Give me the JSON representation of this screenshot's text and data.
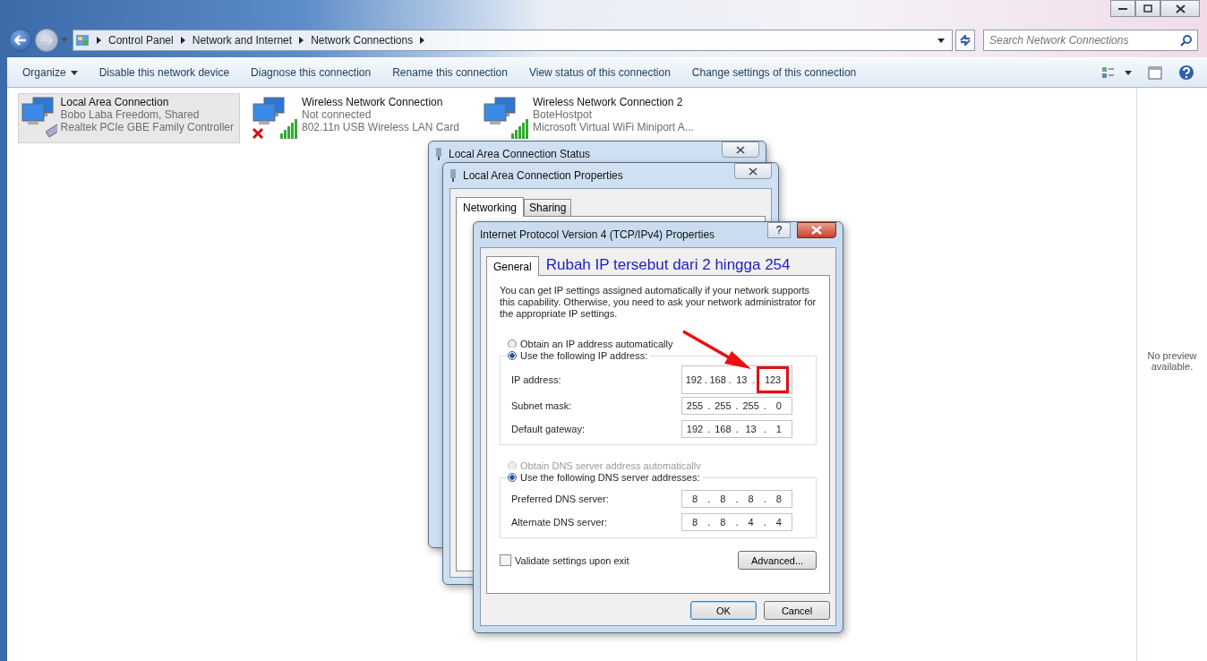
{
  "explorer": {
    "breadcrumb": [
      "Control Panel",
      "Network and Internet",
      "Network Connections"
    ],
    "search": {
      "placeholder": "Search Network Connections"
    }
  },
  "toolbar": [
    {
      "label": "Organize",
      "dropdown": true
    },
    {
      "label": "Disable this network device",
      "dropdown": false
    },
    {
      "label": "Diagnose this connection",
      "dropdown": false
    },
    {
      "label": "Rename this connection",
      "dropdown": false
    },
    {
      "label": "View status of this connection",
      "dropdown": false
    },
    {
      "label": "Change settings of this connection",
      "dropdown": false
    }
  ],
  "connections": [
    {
      "kind": "wired",
      "name": "Local Area Connection",
      "status": "Bobo Laba Freedom, Shared",
      "device": "Realtek PCIe GBE Family Controller",
      "selected": true,
      "disconnected": false
    },
    {
      "kind": "wireless",
      "name": "Wireless Network Connection",
      "status": "Not connected",
      "device": "802.11n USB Wireless LAN Card",
      "selected": false,
      "disconnected": true
    },
    {
      "kind": "wireless",
      "name": "Wireless Network Connection 2",
      "status": "BoteHostpot",
      "device": "Microsoft Virtual WiFi Miniport A...",
      "selected": false,
      "disconnected": false
    }
  ],
  "preview": "No preview available.",
  "status_dialog": {
    "title": "Local Area Connection Status"
  },
  "properties_dialog": {
    "title": "Local Area Connection Properties",
    "tabs": [
      {
        "label": "Networking",
        "selected": true
      },
      {
        "label": "Sharing",
        "selected": false
      }
    ]
  },
  "ipv4_dialog": {
    "title": "Internet Protocol Version 4 (TCP/IPv4) Properties",
    "help": "?",
    "tabs": [
      {
        "label": "General",
        "selected": true
      }
    ],
    "intro": "You can get IP settings assigned automatically if your network supports this capability. Otherwise, you need to ask your network administrator for the appropriate IP settings.",
    "separator": ".",
    "ip_options": [
      {
        "label": "Obtain an IP address automatically",
        "selected": false,
        "disabled": false
      },
      {
        "label": "Use the following IP address:",
        "selected": true,
        "disabled": false
      }
    ],
    "ip_fields": [
      {
        "label": "IP address:",
        "octets": [
          "192",
          "168",
          "13",
          "123"
        ],
        "highlight": true
      },
      {
        "label": "Subnet mask:",
        "octets": [
          "255",
          "255",
          "255",
          "0"
        ],
        "highlight": false
      },
      {
        "label": "Default gateway:",
        "octets": [
          "192",
          "168",
          "13",
          "1"
        ],
        "highlight": false
      }
    ],
    "dns_options": [
      {
        "label": "Obtain DNS server address automatically",
        "selected": false,
        "disabled": true
      },
      {
        "label": "Use the following DNS server addresses:",
        "selected": true,
        "disabled": false
      }
    ],
    "dns_fields": [
      {
        "label": "Preferred DNS server:",
        "octets": [
          "8",
          "8",
          "8",
          "8"
        ],
        "highlight": false
      },
      {
        "label": "Alternate DNS server:",
        "octets": [
          "8",
          "8",
          "4",
          "4"
        ],
        "highlight": false
      }
    ],
    "validate": {
      "label": "Validate settings upon exit",
      "checked": false
    },
    "advanced": "Advanced...",
    "ok": "OK",
    "cancel": "Cancel"
  },
  "annotation": {
    "text": "Rubah IP tersebut dari 2 hingga 254"
  }
}
